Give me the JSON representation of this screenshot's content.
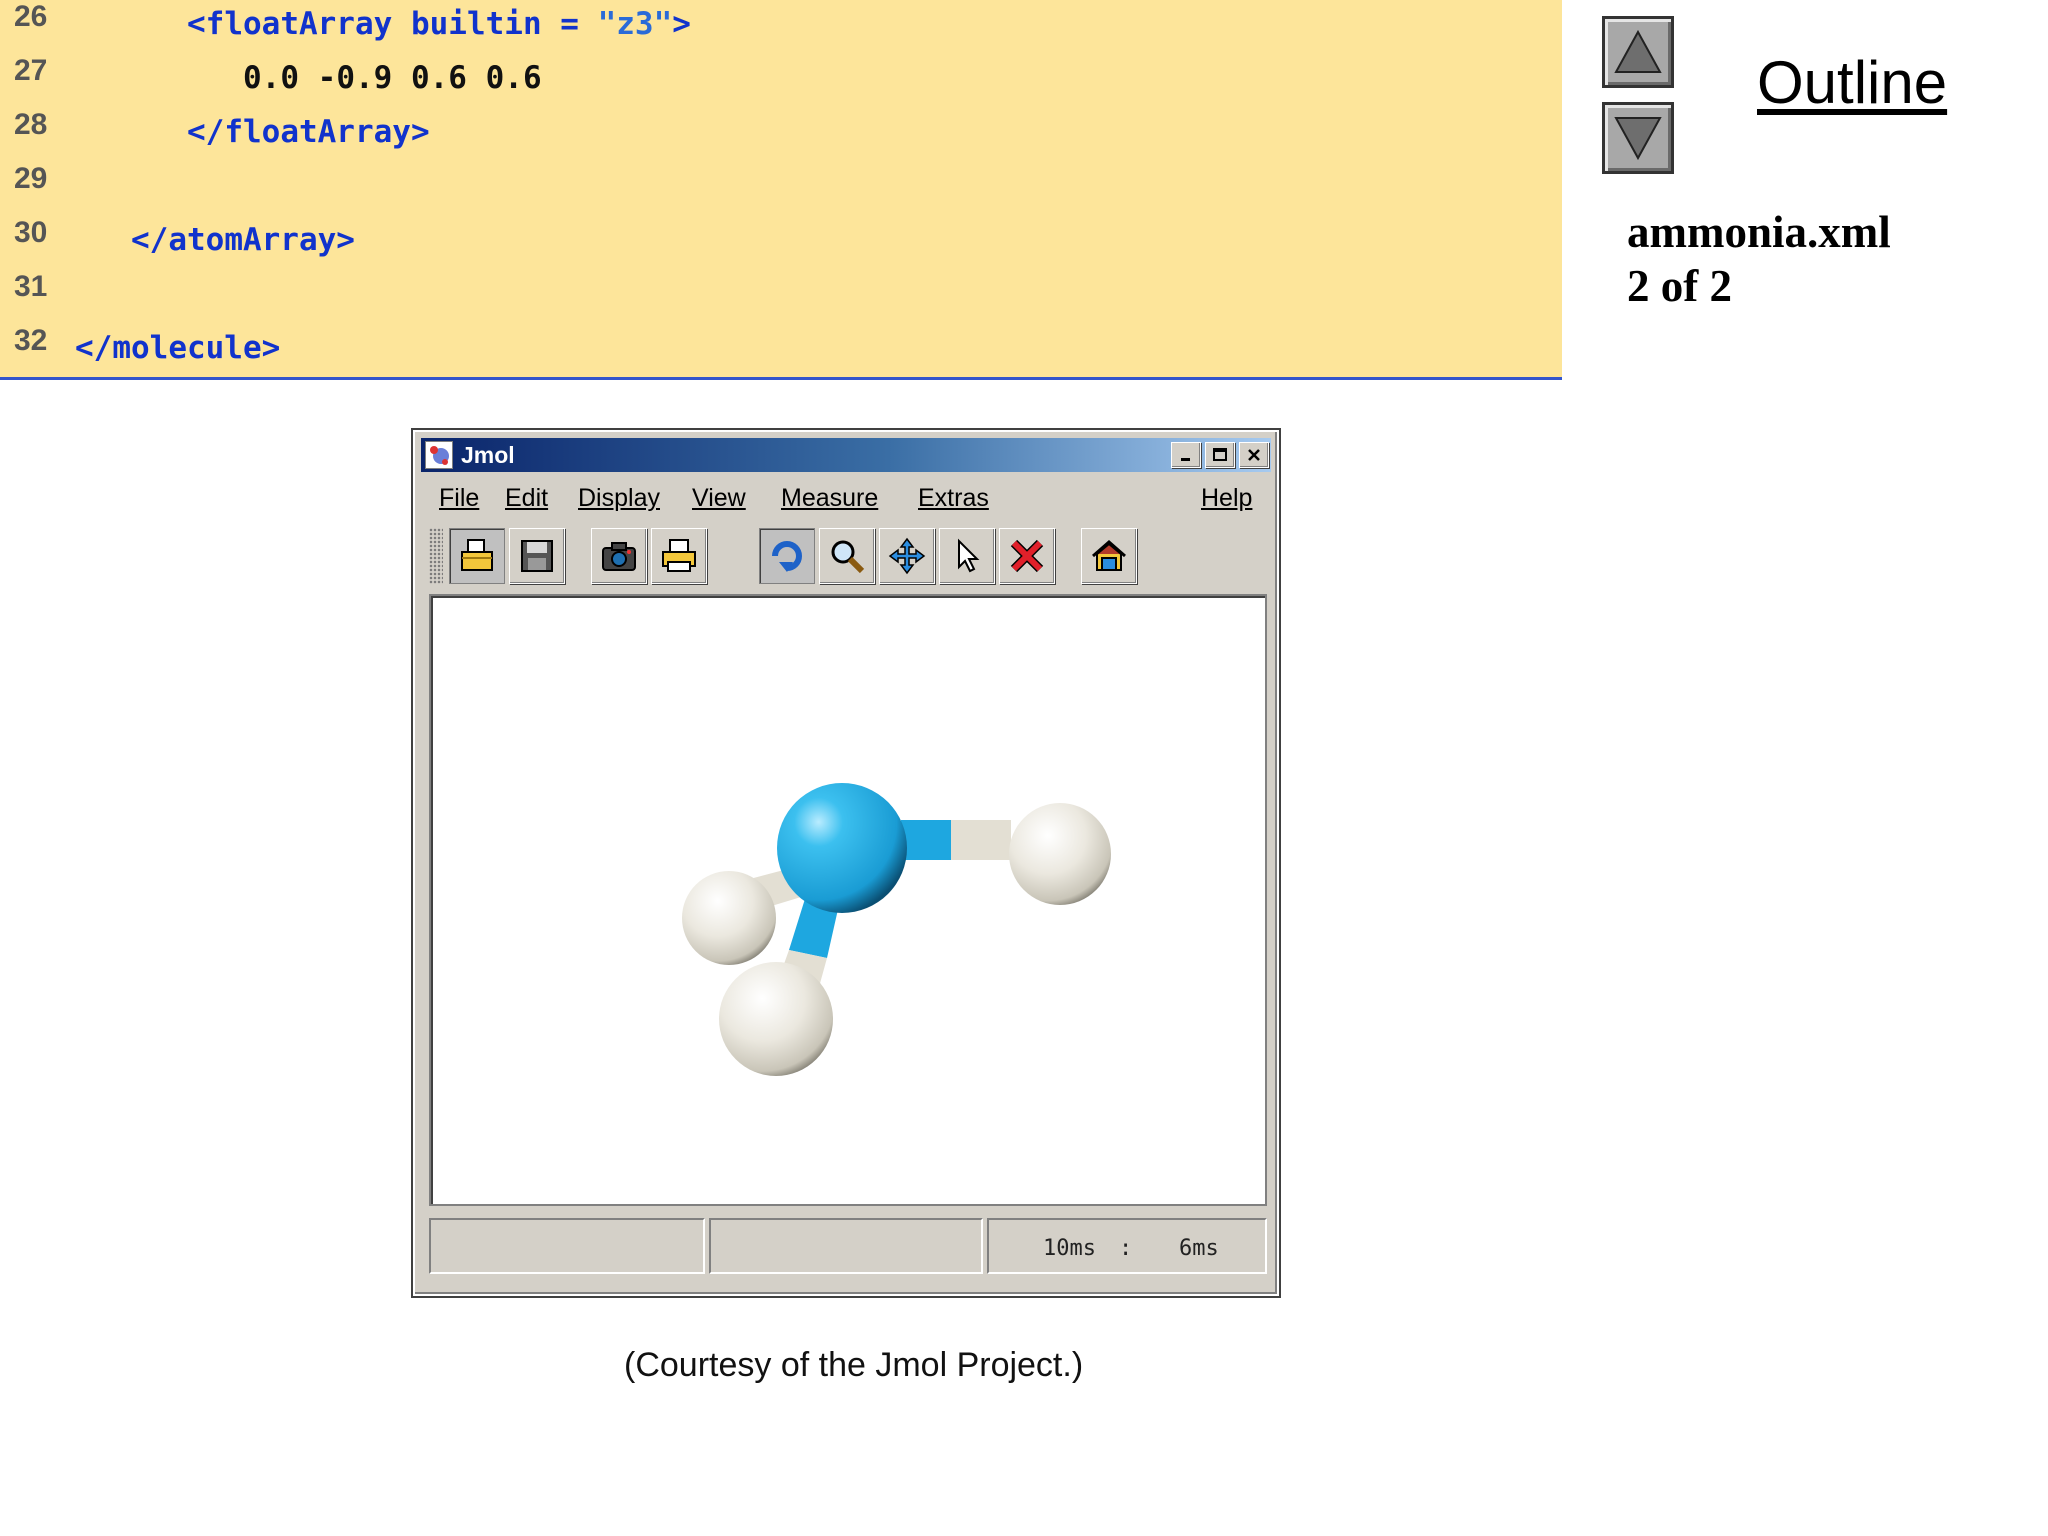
{
  "code": {
    "lines": [
      {
        "num": "26",
        "parts": [
          {
            "t": "<floatArray builtin = ",
            "c": "blue"
          },
          {
            "t": "\"z3\"",
            "c": "str"
          },
          {
            "t": ">",
            "c": "blue"
          }
        ]
      },
      {
        "num": "27",
        "parts": [
          {
            "t": "0.0 -0.9 0.6 0.6",
            "c": "black"
          }
        ]
      },
      {
        "num": "28",
        "parts": [
          {
            "t": "</floatArray>",
            "c": "blue"
          }
        ]
      },
      {
        "num": "29",
        "parts": []
      },
      {
        "num": "30",
        "parts": [
          {
            "t": "</atomArray>",
            "c": "blue"
          }
        ]
      },
      {
        "num": "31",
        "parts": []
      },
      {
        "num": "32",
        "parts": [
          {
            "t": "</molecule>",
            "c": "blue"
          }
        ]
      }
    ]
  },
  "outline": {
    "title": "Outline",
    "file_name": "ammonia.xml",
    "page_count": "2 of 2",
    "up_icon": "triangle-up-icon",
    "down_icon": "triangle-down-icon"
  },
  "jmol": {
    "window_title": "Jmol",
    "menus": [
      {
        "label": "File",
        "accel": 0
      },
      {
        "label": "Edit",
        "accel": 0
      },
      {
        "label": "Display",
        "accel": 0
      },
      {
        "label": "View",
        "accel": 0
      },
      {
        "label": "Measure",
        "accel": 0
      },
      {
        "label": "Extras",
        "accel": 1
      },
      {
        "label": "Help",
        "accel": 0
      }
    ],
    "toolbar_icons": [
      "open-file-icon",
      "save-icon",
      "camera-icon",
      "print-icon",
      "rotate-icon",
      "zoom-icon",
      "move-icon",
      "pointer-icon",
      "delete-icon",
      "home-icon"
    ],
    "status": {
      "cell1": "",
      "cell2": "",
      "timing_left": "10ms",
      "timing_sep": ":",
      "timing_right": "6ms"
    },
    "colors": {
      "nitrogen": "#1ea7e0",
      "hydrogen": "#ece9e0",
      "title_start": "#0a246a",
      "title_end": "#a6caf0"
    }
  },
  "caption": "(Courtesy of the Jmol Project.)"
}
